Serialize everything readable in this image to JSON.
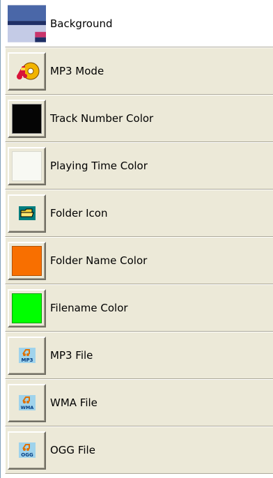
{
  "items": [
    {
      "label": "Background",
      "kind": "background-preview",
      "colors": {
        "main": "#4a67a8",
        "stripe": "#1f2f66",
        "accent": "#c9356b"
      }
    },
    {
      "label": "MP3 Mode",
      "kind": "icon",
      "icon": "mp3-mode-icon"
    },
    {
      "label": "Track Number Color",
      "kind": "swatch",
      "color": "#050505"
    },
    {
      "label": "Playing Time Color",
      "kind": "swatch",
      "color": "#f8f9f3"
    },
    {
      "label": "Folder Icon",
      "kind": "icon",
      "icon": "folder-icon"
    },
    {
      "label": "Folder Name Color",
      "kind": "swatch",
      "color": "#f86f00"
    },
    {
      "label": "Filename Color",
      "kind": "swatch",
      "color": "#00ff00"
    },
    {
      "label": "MP3 File",
      "kind": "icon",
      "icon": "mp3-file-icon",
      "badge": "MP3"
    },
    {
      "label": "WMA File",
      "kind": "icon",
      "icon": "wma-file-icon",
      "badge": "WMA"
    },
    {
      "label": "OGG File",
      "kind": "icon",
      "icon": "ogg-file-icon",
      "badge": "OGG"
    }
  ]
}
